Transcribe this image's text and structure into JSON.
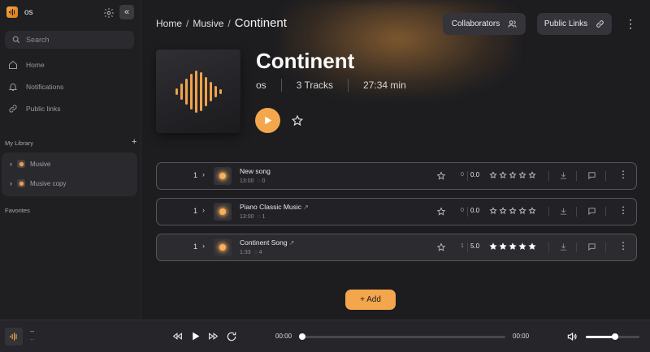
{
  "sidebar": {
    "brand_name": "os",
    "search_placeholder": "Search",
    "nav": [
      {
        "label": "Home",
        "icon": "home-icon"
      },
      {
        "label": "Notifications",
        "icon": "bell-icon"
      },
      {
        "label": "Public links",
        "icon": "link-icon"
      }
    ],
    "library_title": "My Library",
    "library_add": "+",
    "library_items": [
      {
        "label": "Musive"
      },
      {
        "label": "Musive copy"
      }
    ],
    "favorites_title": "Favorites"
  },
  "header": {
    "breadcrumb": [
      "Home",
      "Musive"
    ],
    "current": "Continent",
    "collaborators_label": "Collaborators",
    "public_links_label": "Public Links"
  },
  "album": {
    "title": "Continent",
    "owner": "os",
    "tracks_label": "3 Tracks",
    "duration": "27:34 min"
  },
  "tracks": [
    {
      "num": "1",
      "title": "New song",
      "external": false,
      "duration": "13:00",
      "comments": "0",
      "rating_count": "0",
      "score": "0.0",
      "stars": 0
    },
    {
      "num": "1",
      "title": "Piano Classic Music",
      "external": true,
      "duration": "13:00",
      "comments": "1",
      "rating_count": "0",
      "score": "0.0",
      "stars": 0
    },
    {
      "num": "1",
      "title": "Continent Song",
      "external": true,
      "duration": "1:33",
      "comments": "4",
      "rating_count": "1",
      "score": "5.0",
      "stars": 5
    }
  ],
  "add_button_label": "+ Add",
  "player": {
    "title": "--",
    "subtitle": "--",
    "time_current": "00:00",
    "time_total": "00:00",
    "progress": 0,
    "volume": 0.55
  },
  "colors": {
    "accent": "#f4a64c",
    "background": "#1d1d20",
    "sidebar": "#1f1f22"
  }
}
